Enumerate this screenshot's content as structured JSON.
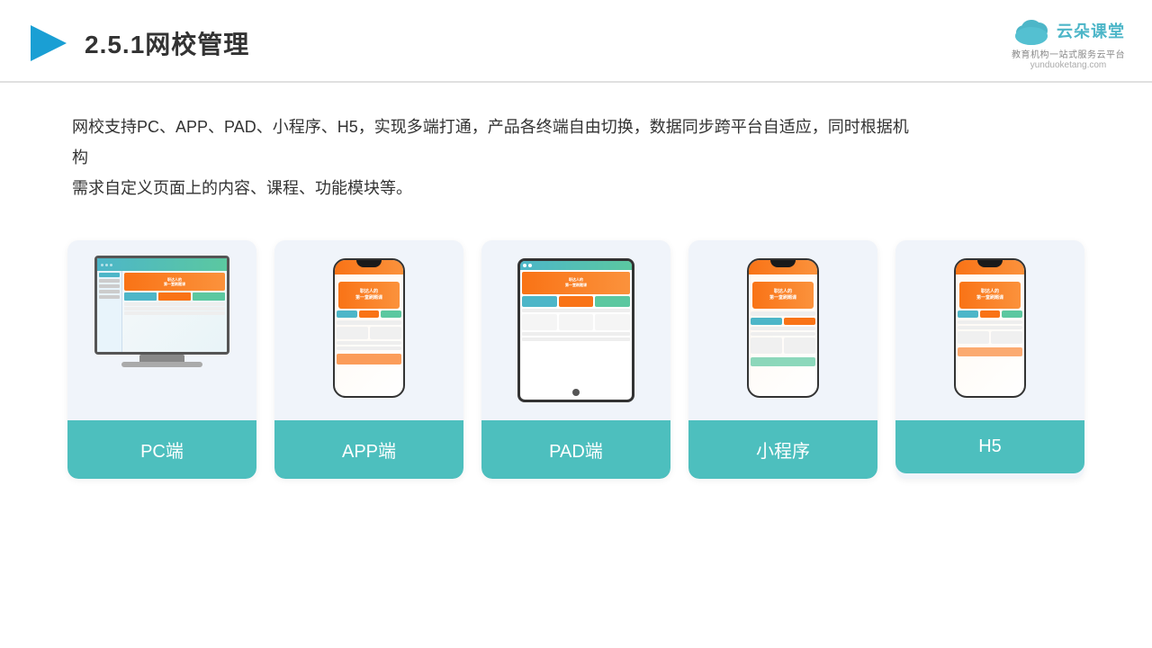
{
  "header": {
    "title": "2.5.1网校管理",
    "logo_name": "云朵课堂",
    "logo_url": "yunduoketang.com",
    "logo_subtitle": "教育机构一站式服务云平台"
  },
  "description": {
    "text": "网校支持PC、APP、PAD、小程序、H5，实现多端打通，产品各终端自由切换，数据同步跨平台自适应，同时根据机构需求自定义页面上的内容、课程、功能模块等。"
  },
  "cards": [
    {
      "id": "pc",
      "label": "PC端"
    },
    {
      "id": "app",
      "label": "APP端"
    },
    {
      "id": "pad",
      "label": "PAD端"
    },
    {
      "id": "miniprogram",
      "label": "小程序"
    },
    {
      "id": "h5",
      "label": "H5"
    }
  ],
  "colors": {
    "teal": "#4dbfbe",
    "accent": "#4db6c8",
    "orange": "#f97316",
    "dark": "#333333",
    "card_bg": "#f0f4fa"
  }
}
